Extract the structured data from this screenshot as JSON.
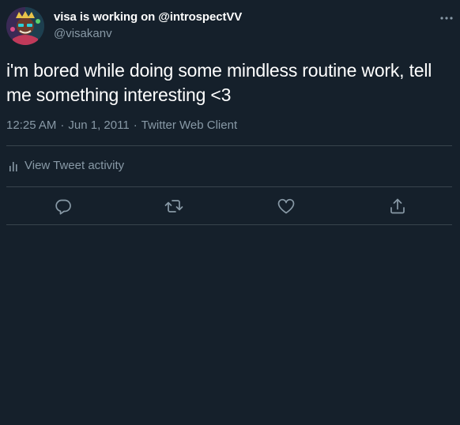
{
  "author": {
    "display_name": "visa is working on @introspectVV",
    "handle": "@visakanv"
  },
  "tweet": {
    "text": "i'm bored while doing some mindless routine work, tell me something interesting <3",
    "time": "12:25 AM",
    "date": "Jun 1, 2011",
    "source": "Twitter Web Client",
    "separator": "·"
  },
  "activity": {
    "label": "View Tweet activity"
  },
  "icons": {
    "more": "more-horizontal-icon",
    "activity": "bar-chart-icon",
    "reply": "reply-icon",
    "retweet": "retweet-icon",
    "like": "heart-icon",
    "share": "share-icon"
  },
  "colors": {
    "background": "#15202b",
    "text_primary": "#ffffff",
    "text_secondary": "#8899a6",
    "divider": "#38444d"
  }
}
